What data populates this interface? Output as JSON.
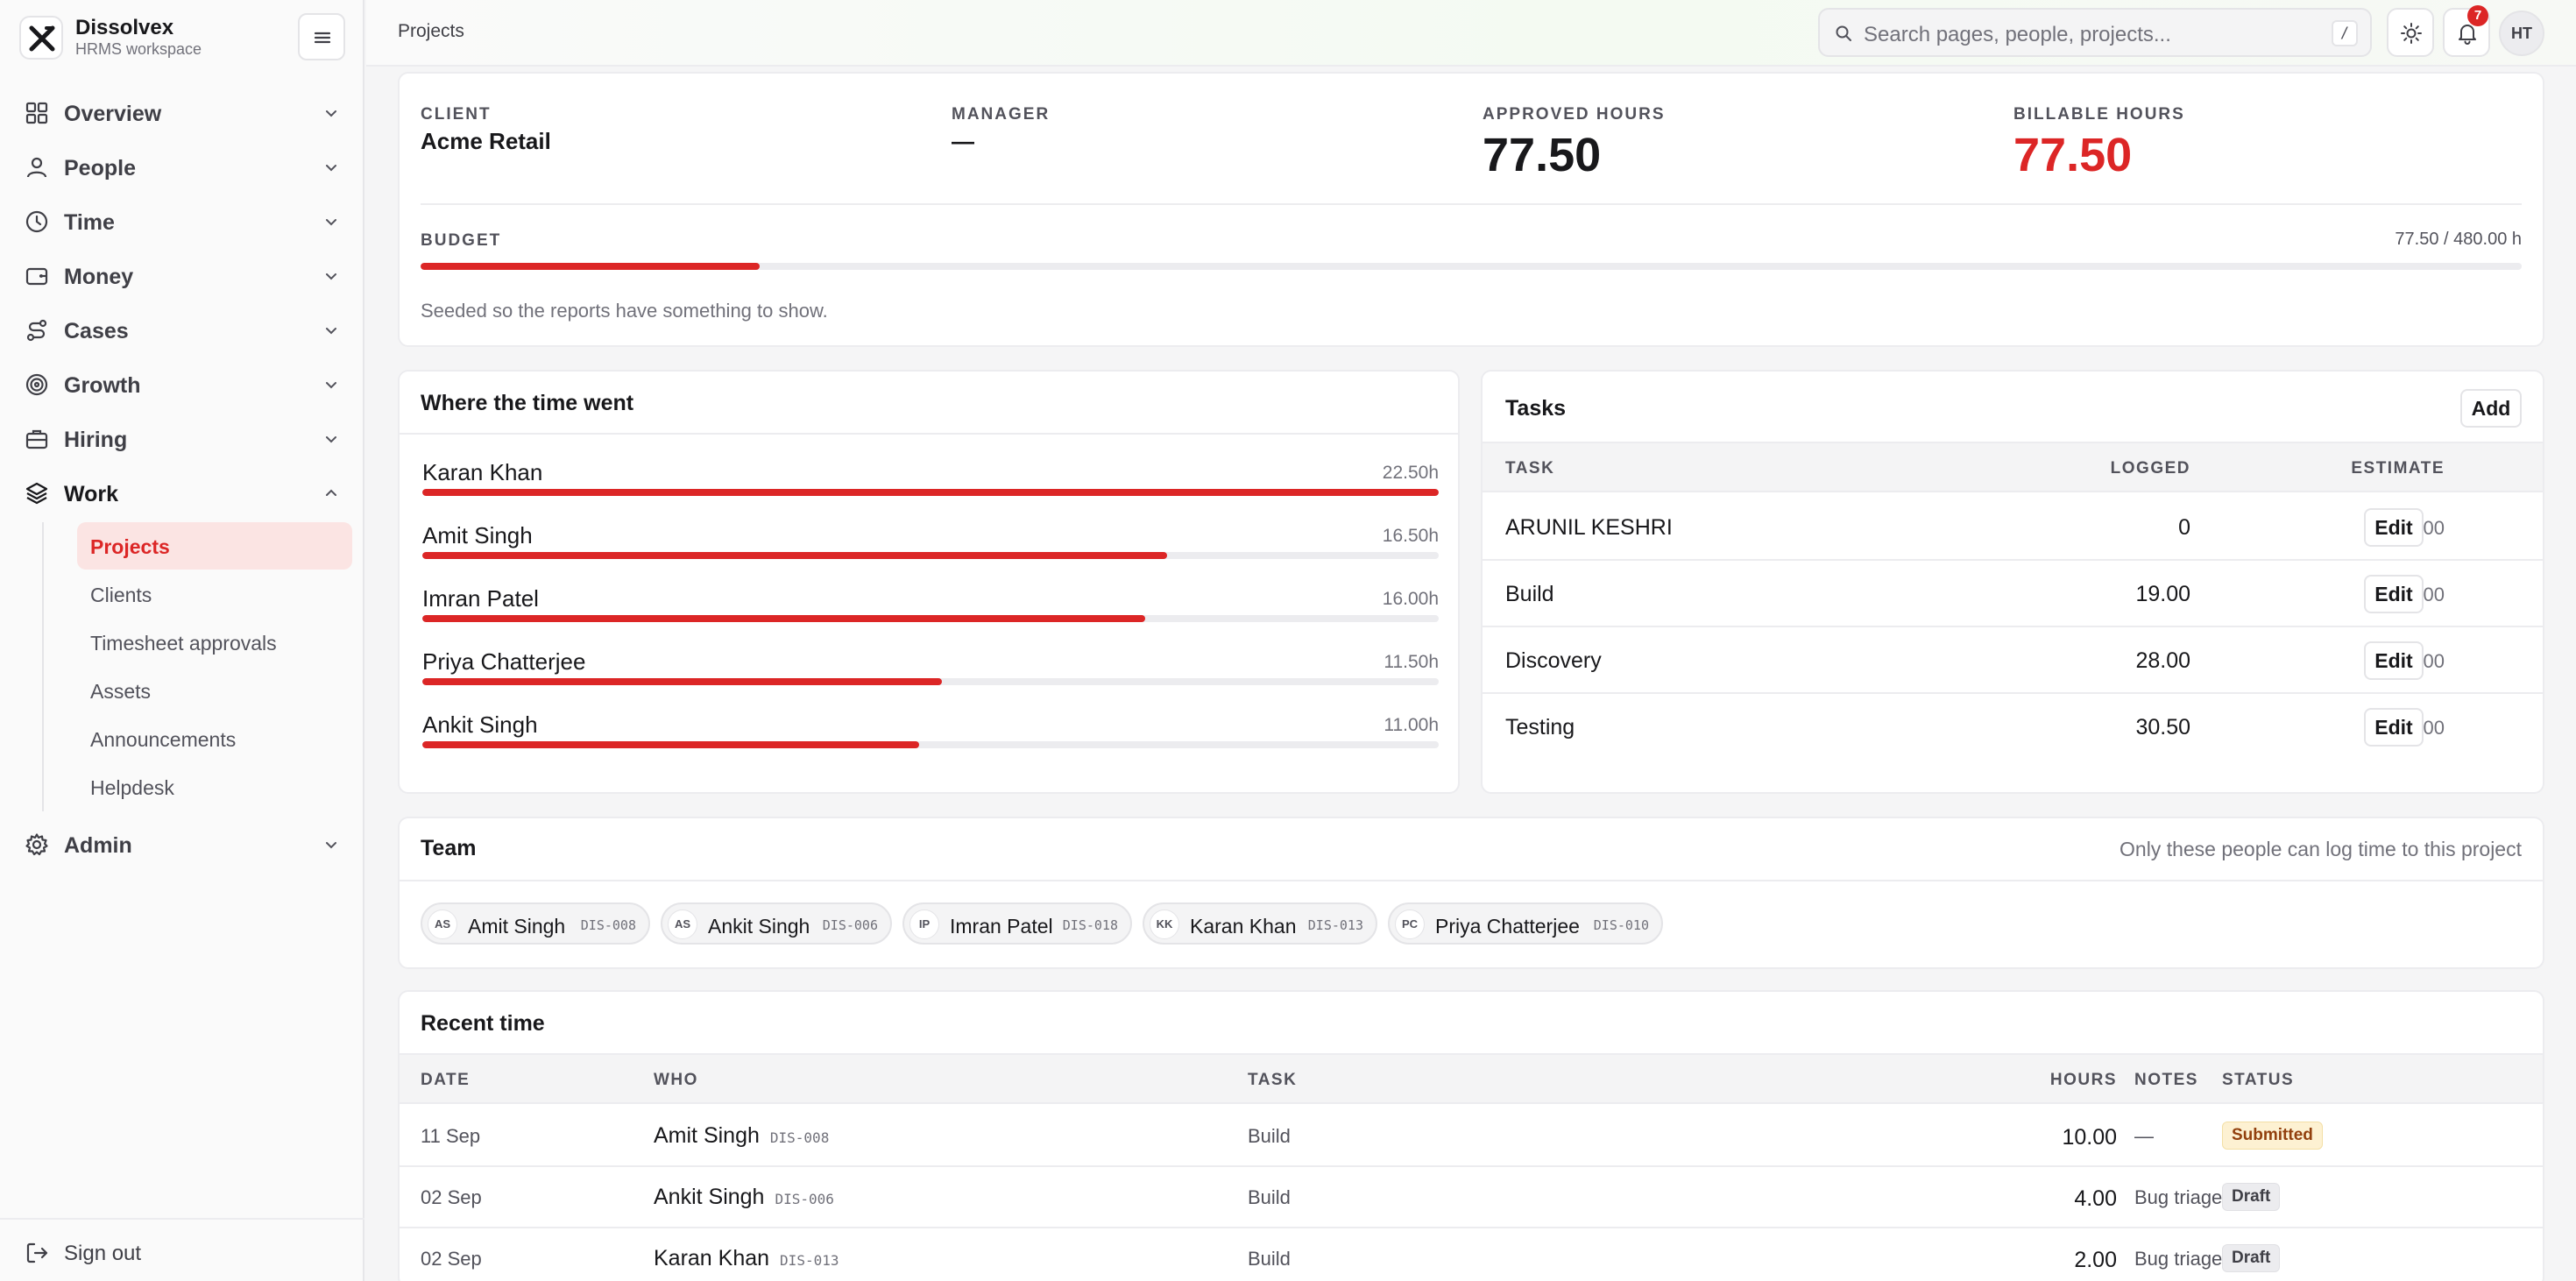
{
  "brand": {
    "name": "Dissolvex",
    "subtitle": "HRMS workspace"
  },
  "sidebar": {
    "items": [
      {
        "label": "Overview",
        "icon": "grid-icon"
      },
      {
        "label": "People",
        "icon": "user-icon"
      },
      {
        "label": "Time",
        "icon": "clock-icon"
      },
      {
        "label": "Money",
        "icon": "wallet-icon"
      },
      {
        "label": "Cases",
        "icon": "route-icon"
      },
      {
        "label": "Growth",
        "icon": "target-icon"
      },
      {
        "label": "Hiring",
        "icon": "briefcase-icon"
      },
      {
        "label": "Work",
        "icon": "layers-icon",
        "expanded": true
      },
      {
        "label": "Admin",
        "icon": "gear-icon"
      }
    ],
    "work_children": [
      {
        "label": "Projects",
        "active": true
      },
      {
        "label": "Clients"
      },
      {
        "label": "Timesheet approvals"
      },
      {
        "label": "Assets"
      },
      {
        "label": "Announcements"
      },
      {
        "label": "Helpdesk"
      }
    ],
    "signout": "Sign out"
  },
  "header": {
    "breadcrumb": "Projects",
    "search_placeholder": "Search pages, people, projects...",
    "search_shortcut": "/",
    "notifications_count": "7",
    "avatar_initials": "HT"
  },
  "summary": {
    "client_label": "CLIENT",
    "client_value": "Acme Retail",
    "manager_label": "MANAGER",
    "manager_value": "—",
    "approved_label": "APPROVED HOURS",
    "approved_value": "77.50",
    "billable_label": "BILLABLE HOURS",
    "billable_value": "77.50",
    "budget_label": "BUDGET",
    "budget_text": "77.50 / 480.00 h",
    "budget_fraction": 0.1615,
    "note": "Seeded so the reports have something to show.",
    "accent_color": "#dc2626"
  },
  "time_went": {
    "title": "Where the time went",
    "rows": [
      {
        "name": "Karan Khan",
        "hours": "22.50h",
        "fraction": 1.0
      },
      {
        "name": "Amit Singh",
        "hours": "16.50h",
        "fraction": 0.733
      },
      {
        "name": "Imran Patel",
        "hours": "16.00h",
        "fraction": 0.711
      },
      {
        "name": "Priya Chatterjee",
        "hours": "11.50h",
        "fraction": 0.511
      },
      {
        "name": "Ankit Singh",
        "hours": "11.00h",
        "fraction": 0.489
      }
    ]
  },
  "tasks": {
    "title": "Tasks",
    "add_label": "Add",
    "columns": {
      "task": "TASK",
      "logged": "LOGGED",
      "estimate": "ESTIMATE"
    },
    "edit_label": "Edit",
    "rows": [
      {
        "task": "ARUNIL KESHRI",
        "logged": "0",
        "estimate": "3.00"
      },
      {
        "task": "Build",
        "logged": "19.00",
        "estimate": "200.00"
      },
      {
        "task": "Discovery",
        "logged": "28.00",
        "estimate": "40.00"
      },
      {
        "task": "Testing",
        "logged": "30.50",
        "estimate": "60.00"
      }
    ]
  },
  "team": {
    "title": "Team",
    "hint": "Only these people can log time to this project",
    "members": [
      {
        "initials": "AS",
        "name": "Amit Singh",
        "code": "DIS-008"
      },
      {
        "initials": "AS",
        "name": "Ankit Singh",
        "code": "DIS-006"
      },
      {
        "initials": "IP",
        "name": "Imran Patel",
        "code": "DIS-018"
      },
      {
        "initials": "KK",
        "name": "Karan Khan",
        "code": "DIS-013"
      },
      {
        "initials": "PC",
        "name": "Priya Chatterjee",
        "code": "DIS-010"
      }
    ]
  },
  "recent": {
    "title": "Recent time",
    "columns": {
      "date": "DATE",
      "who": "WHO",
      "task": "TASK",
      "hours": "HOURS",
      "notes": "NOTES",
      "status": "STATUS"
    },
    "rows": [
      {
        "date": "11 Sep",
        "who": "Amit Singh",
        "code": "DIS-008",
        "task": "Build",
        "hours": "10.00",
        "notes": "—",
        "status": "Submitted",
        "status_kind": "submitted"
      },
      {
        "date": "02 Sep",
        "who": "Ankit Singh",
        "code": "DIS-006",
        "task": "Build",
        "hours": "4.00",
        "notes": "Bug triage",
        "status": "Draft",
        "status_kind": "draft"
      },
      {
        "date": "02 Sep",
        "who": "Karan Khan",
        "code": "DIS-013",
        "task": "Build",
        "hours": "2.00",
        "notes": "Bug triage",
        "status": "Draft",
        "status_kind": "draft"
      }
    ]
  }
}
